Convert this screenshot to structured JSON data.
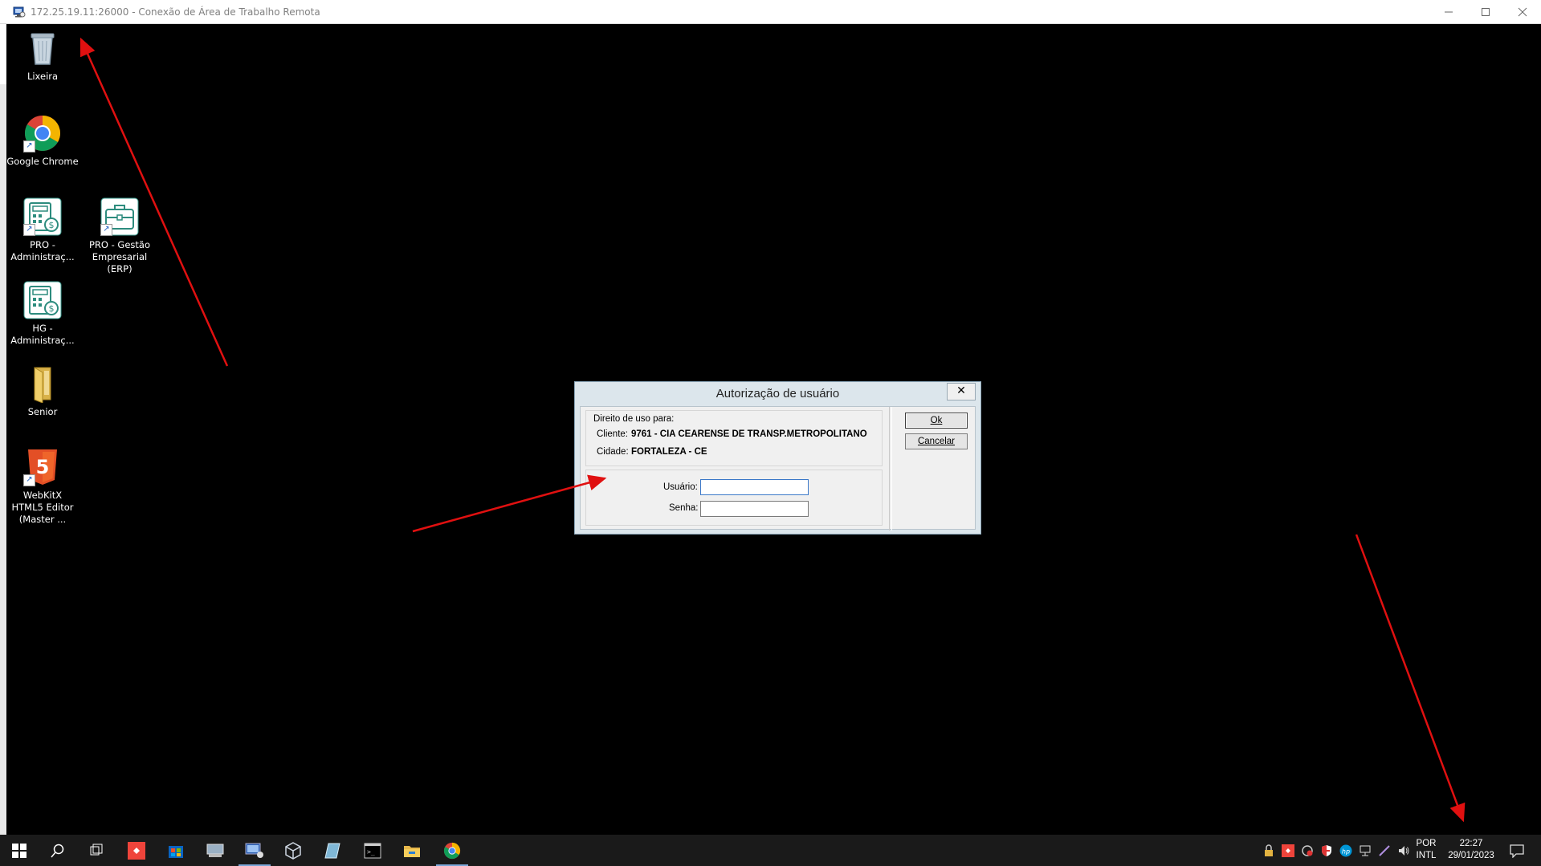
{
  "window": {
    "title": "172.25.19.11:26000 - Conexão de Área de Trabalho Remota",
    "controls": [
      "minimize-icon",
      "maximize-icon",
      "close-icon"
    ]
  },
  "desktop": {
    "icons": [
      {
        "label": "Lixeira",
        "icon": "recycle-bin-icon"
      },
      {
        "label": "Google Chrome",
        "icon": "chrome-icon"
      },
      {
        "label": "PRO - Administraç...",
        "icon": "pro-admin-icon"
      },
      {
        "label": "PRO - Gestão Empresarial (ERP)",
        "icon": "pro-erp-icon"
      },
      {
        "label": "HG - Administraç...",
        "icon": "hg-admin-icon"
      },
      {
        "label": "Senior",
        "icon": "folder-icon"
      },
      {
        "label": "WebKitX HTML5 Editor (Master ...",
        "icon": "html5-icon"
      }
    ]
  },
  "dialog": {
    "title": "Autorização de usuário",
    "section_label": "Direito de uso para:",
    "cliente_label": "Cliente:",
    "cliente_value": "9761 - CIA CEARENSE DE TRANSP.METROPOLITANO",
    "cidade_label": "Cidade:",
    "cidade_value": "FORTALEZA - CE",
    "usuario_label": "Usuário:",
    "usuario_value": "",
    "senha_label": "Senha:",
    "senha_value": "",
    "ok_label": "Ok",
    "cancel_label": "Cancelar"
  },
  "taskbar": {
    "apps": [
      "start-icon",
      "search-icon",
      "task-view-icon",
      "anydesk-icon",
      "store-icon",
      "network-drive-icon",
      "remote-desktop-icon",
      "virtualbox-icon",
      "notepad-icon",
      "terminal-icon",
      "file-explorer-icon",
      "chrome-icon"
    ],
    "active_apps": [
      "remote-desktop-icon",
      "chrome-icon"
    ],
    "language_line1": "POR",
    "language_line2": "INTL",
    "time": "22:27",
    "date": "29/01/2023"
  },
  "colors": {
    "desktop_bg": "#000000",
    "taskbar_bg": "#1a1a1a",
    "dialog_frame": "#dce6ec",
    "annotation_arrow": "#e01010"
  }
}
